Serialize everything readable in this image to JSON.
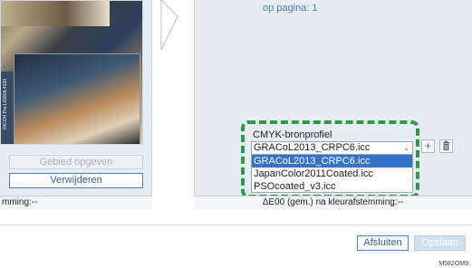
{
  "left_panel": {
    "preview_caption": "RICOH Pro L4160/L4130",
    "specify_area_button": "Gebied opgeven",
    "delete_button": "Verwijderen",
    "status_text": "mming:--"
  },
  "right_panel": {
    "page_indicator": "op pagina:  1",
    "cmyk_source_label": "CMYK-bronprofiel",
    "cmyk_source_value": "GRACoL2013_CRPC6.icc",
    "cmyk_source_options": [
      "GRACoL2013_CRPC6.icc",
      "JapanColor2011Coated.icc",
      "PSOcoated_v3.icc"
    ],
    "selected_option_index": 0,
    "add_icon": "plus-icon",
    "delete_icon": "trash-icon",
    "status_text": "ΔE00 (gem.) na kleurafstemming:--"
  },
  "footer": {
    "close_button": "Afsluiten",
    "save_button": "Opslaan",
    "document_code": "M582OM9"
  },
  "colors": {
    "accent": "#3573c7",
    "highlight_frame": "#2f9a45",
    "panel_bg": "#e6edf4"
  }
}
